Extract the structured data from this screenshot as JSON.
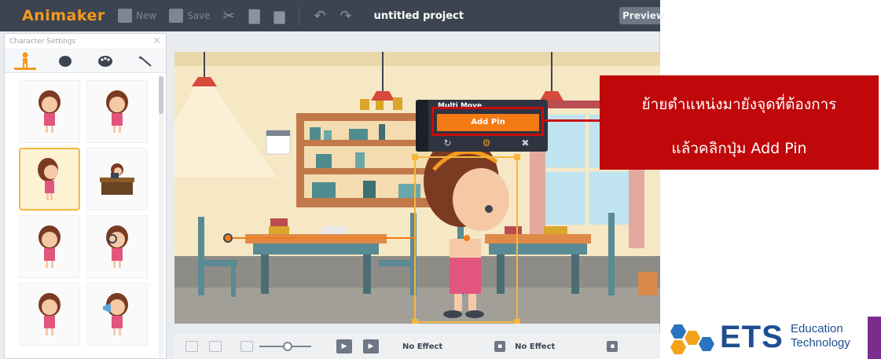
{
  "app": {
    "logo": "Animaker",
    "project_title": "untitled project",
    "toolbar": {
      "new_label": "New",
      "save_label": "Save",
      "preview_label": "Preview"
    }
  },
  "panel": {
    "title": "Character Settings",
    "tabs": [
      "character-icon",
      "costume-icon",
      "color-palette-icon",
      "magic-wand-icon"
    ],
    "selected_thumbnail_index": 2
  },
  "popup": {
    "title": "Multi Move",
    "add_pin_label": "Add Pin"
  },
  "bottombar": {
    "effect_in": "No Effect",
    "effect_out": "No Effect"
  },
  "callout": {
    "line1": "ย้ายตำแหน่งมายังจุดที่ต้องการ",
    "line2": "แล้วคลิกปุ่ม Add Pin"
  },
  "ets_logo": {
    "brand": "ETS",
    "line1": "Education",
    "line2": "Technology"
  },
  "colors": {
    "topbar": "#3d4451",
    "accent": "#f39a1e",
    "callout": "#c0070a",
    "add_pin": "#f47a14",
    "ets_blue": "#1d4f91"
  }
}
